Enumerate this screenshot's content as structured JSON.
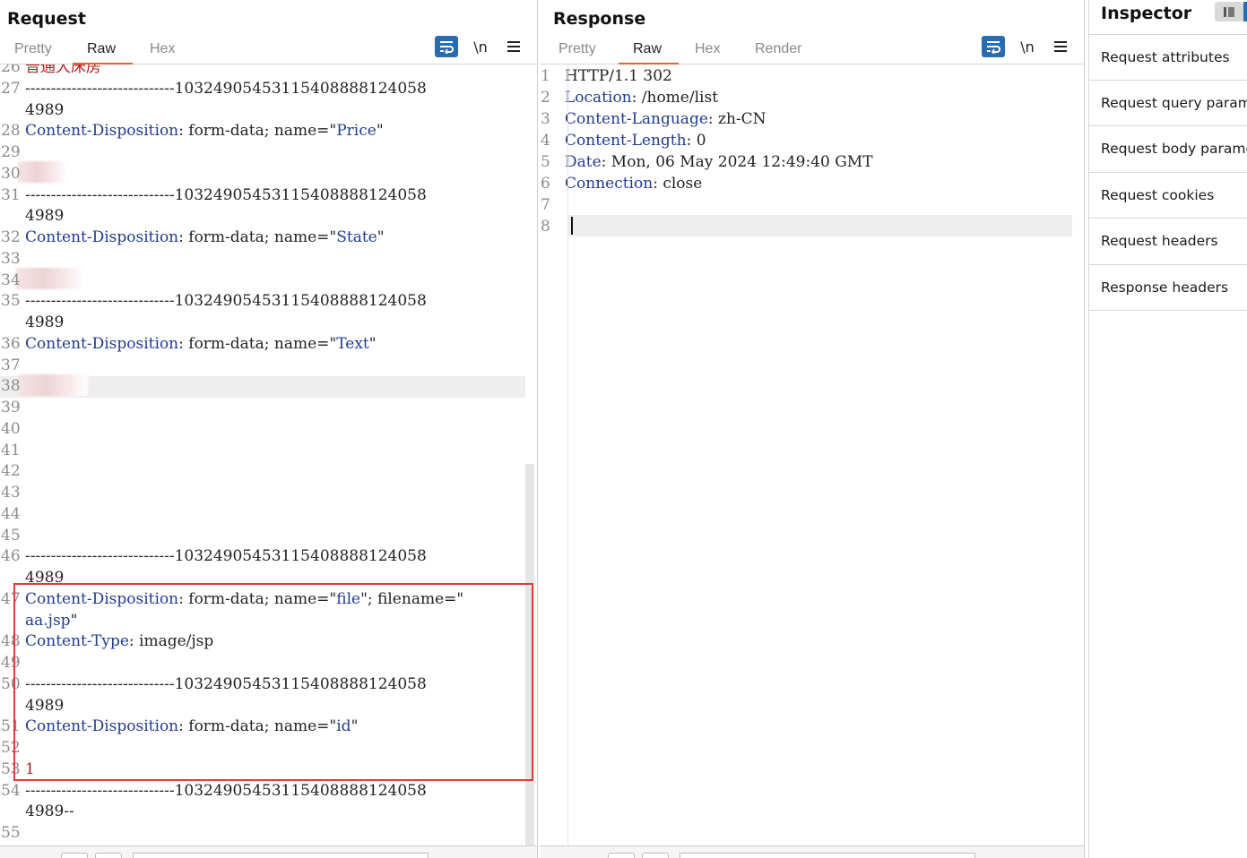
{
  "request": {
    "title": "Request",
    "tabs": [
      "Pretty",
      "Raw",
      "Hex"
    ],
    "active_tab": "Raw",
    "toolbar": {
      "newline_label": "\\n",
      "menu_icon": "hamburger-icon",
      "wrap_icon": "wrap-lines-icon"
    },
    "lines": [
      {
        "n": "26",
        "text": "普通大床房",
        "style": "red"
      },
      {
        "n": "27",
        "text": "-----------------------------10324905453115408888124058"
      },
      {
        "n": "",
        "text": "4989"
      },
      {
        "n": "28",
        "key": "Content-Disposition",
        "rest": ": form-data; name=\"",
        "val": "Price",
        "tail": "\""
      },
      {
        "n": "29",
        "text": ""
      },
      {
        "n": "30",
        "text": ""
      },
      {
        "n": "31",
        "text": "-----------------------------10324905453115408888124058"
      },
      {
        "n": "",
        "text": "4989"
      },
      {
        "n": "32",
        "key": "Content-Disposition",
        "rest": ": form-data; name=\"",
        "val": "State",
        "tail": "\""
      },
      {
        "n": "33",
        "text": ""
      },
      {
        "n": "34",
        "text": ""
      },
      {
        "n": "35",
        "text": "-----------------------------10324905453115408888124058"
      },
      {
        "n": "",
        "text": "4989"
      },
      {
        "n": "36",
        "key": "Content-Disposition",
        "rest": ": form-data; name=\"",
        "val": "Text",
        "tail": "\""
      },
      {
        "n": "37",
        "text": ""
      },
      {
        "n": "38",
        "text": ""
      },
      {
        "n": "39",
        "text": ""
      },
      {
        "n": "40",
        "text": ""
      },
      {
        "n": "41",
        "text": ""
      },
      {
        "n": "42",
        "text": ""
      },
      {
        "n": "43",
        "text": ""
      },
      {
        "n": "44",
        "text": ""
      },
      {
        "n": "45",
        "text": ""
      },
      {
        "n": "46",
        "text": "-----------------------------10324905453115408888124058"
      },
      {
        "n": "",
        "text": "4989"
      },
      {
        "n": "47",
        "key": "Content-Disposition",
        "rest": ": form-data; name=\"",
        "val": "file",
        "tail": "\"; filename=\""
      },
      {
        "n": "",
        "val2": "aa.jsp",
        "tail2": "\""
      },
      {
        "n": "48",
        "key": "Content-Type",
        "rest": ": image/jsp"
      },
      {
        "n": "49",
        "text": ""
      },
      {
        "n": "50",
        "text": "-----------------------------10324905453115408888124058"
      },
      {
        "n": "",
        "text": "4989"
      },
      {
        "n": "51",
        "key": "Content-Disposition",
        "rest": ": form-data; name=\"",
        "val": "id",
        "tail": "\""
      },
      {
        "n": "52",
        "text": ""
      },
      {
        "n": "53",
        "text": "1",
        "style": "red"
      },
      {
        "n": "54",
        "text": "-----------------------------10324905453115408888124058"
      },
      {
        "n": "",
        "text": "4989--"
      },
      {
        "n": "55",
        "text": ""
      }
    ]
  },
  "response": {
    "title": "Response",
    "tabs": [
      "Pretty",
      "Raw",
      "Hex",
      "Render"
    ],
    "active_tab": "Raw",
    "toolbar": {
      "newline_label": "\\n",
      "menu_icon": "hamburger-icon",
      "wrap_icon": "wrap-lines-icon"
    },
    "lines": [
      {
        "n": "1",
        "text": "HTTP/1.1 302"
      },
      {
        "n": "2",
        "key": "Location",
        "rest": ": /home/list"
      },
      {
        "n": "3",
        "key": "Content-Language",
        "rest": ": zh-CN"
      },
      {
        "n": "4",
        "key": "Content-Length",
        "rest": ": 0"
      },
      {
        "n": "5",
        "key": "Date",
        "rest": ": Mon, 06 May 2024 12:49:40 GMT"
      },
      {
        "n": "6",
        "key": "Connection",
        "rest": ": close"
      },
      {
        "n": "7",
        "text": ""
      },
      {
        "n": "8",
        "text": ""
      }
    ]
  },
  "inspector": {
    "title": "Inspector",
    "items": [
      "Request attributes",
      "Request query parameters",
      "Request body parameters",
      "Request cookies",
      "Request headers",
      "Response headers"
    ]
  },
  "colors": {
    "accent": "#e8612c",
    "header_key": "#213b8f",
    "value_red": "#b01c1c",
    "selection_box": "#e53a3a",
    "button_blue": "#2b6cb0"
  }
}
